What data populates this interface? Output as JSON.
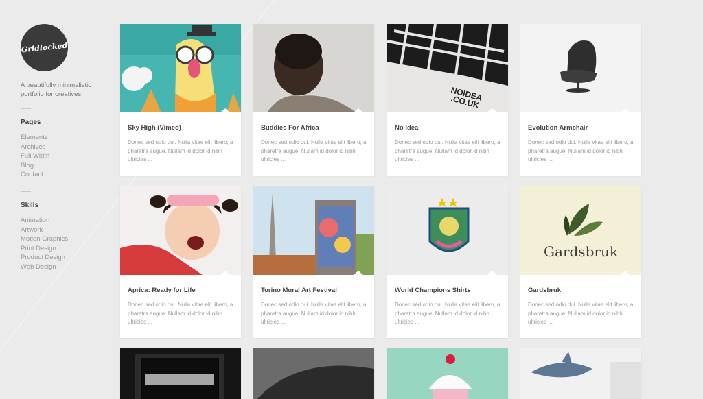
{
  "logo": {
    "text": "Gridlocked"
  },
  "tagline": "A beautifully minimalistic portfolio for creatives.",
  "pages": {
    "title": "Pages",
    "items": [
      "Elements",
      "Archives",
      "Full Width",
      "Blog",
      "Contact"
    ]
  },
  "skills": {
    "title": "Skills",
    "items": [
      "Animation",
      "Artwork",
      "Motion Graphics",
      "Print Design",
      "Product Design",
      "Web Design"
    ]
  },
  "cards": [
    {
      "title": "Sky High (Vimeo)",
      "desc": "Donec sed odio dui. Nulla vitae elit libero, a pharetra augue. Nullam id dolor id nibh ultricies ..."
    },
    {
      "title": "Buddies For Africa",
      "desc": "Donec sed odio dui. Nulla vitae elit libero, a pharetra augue. Nullam id dolor id nibh ultricies ..."
    },
    {
      "title": "No Idea",
      "desc": "Donec sed odio dui. Nulla vitae elit libero, a pharetra augue. Nullam id dolor id nibh ultricies ..."
    },
    {
      "title": "Evolution Armchair",
      "desc": "Donec sed odio dui. Nulla vitae elit libero, a pharetra augue. Nullam id dolor id nibh ultricies ..."
    },
    {
      "title": "Aprica: Ready for Life",
      "desc": "Donec sed odio dui. Nulla vitae elit libero, a pharetra augue. Nullam id dolor id nibh ultricies ..."
    },
    {
      "title": "Torino Mural Art Festival",
      "desc": "Donec sed odio dui. Nulla vitae elit libero, a pharetra augue. Nullam id dolor id nibh ultricies ..."
    },
    {
      "title": "World Champions Shirts",
      "desc": "Donec sed odio dui. Nulla vitae elit libero, a pharetra augue. Nullam id dolor id nibh ultricies ..."
    },
    {
      "title": "Gardsbruk",
      "desc": "Donec sed odio dui. Nulla vitae elit libero, a pharetra augue. Nullam id dolor id nibh ultricies ..."
    }
  ],
  "thumb_text": {
    "no_idea": "NOIDEA .CO.UK",
    "gardsbruk": "Gardsbruk"
  }
}
